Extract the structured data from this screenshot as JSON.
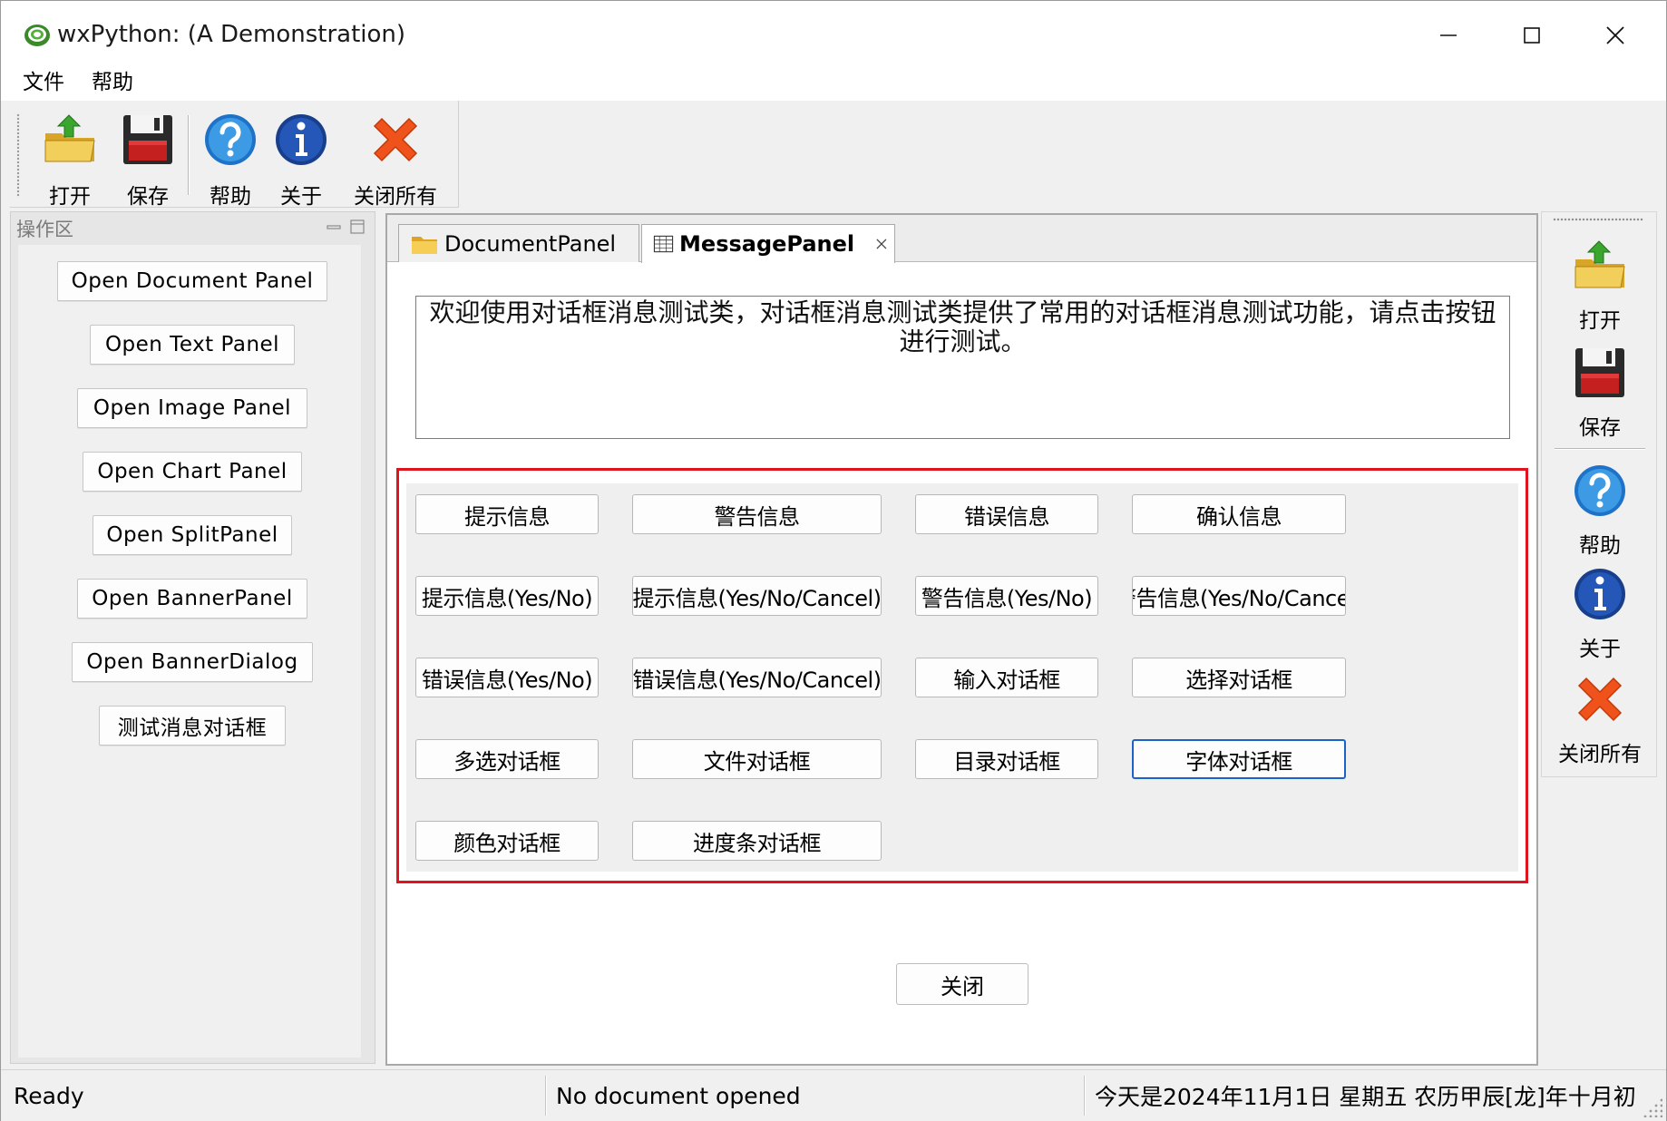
{
  "window": {
    "title": "wxPython: (A Demonstration)"
  },
  "menu": {
    "items": [
      "文件",
      "帮助"
    ]
  },
  "toolbar_top": {
    "items": [
      {
        "label": "打开",
        "icon": "open-folder-icon"
      },
      {
        "label": "保存",
        "icon": "save-disk-icon"
      },
      {
        "label": "帮助",
        "icon": "help-icon"
      },
      {
        "label": "关于",
        "icon": "info-icon"
      },
      {
        "label": "关闭所有",
        "icon": "close-all-icon"
      }
    ]
  },
  "left_pane": {
    "caption": "操作区",
    "buttons": [
      "Open Document Panel",
      "Open Text Panel",
      "Open Image Panel",
      "Open Chart Panel",
      "Open SplitPanel",
      "Open BannerPanel",
      "Open BannerDialog",
      "测试消息对话框"
    ]
  },
  "notebook": {
    "tabs": [
      {
        "label": "DocumentPanel",
        "icon": "folder-icon",
        "active": false
      },
      {
        "label": "MessagePanel",
        "icon": "grid-icon",
        "active": true
      }
    ],
    "message_text": "欢迎使用对话框消息测试类，对话框消息测试类提供了常用的对话框消息测试功能，请点击按钮进行测试。",
    "buttons": [
      [
        "提示信息",
        "警告信息",
        "错误信息",
        "确认信息"
      ],
      [
        "提示信息(Yes/No)",
        "提示信息(Yes/No/Cancel)",
        "警告信息(Yes/No)",
        "警告信息(Yes/No/Cancel)"
      ],
      [
        "错误信息(Yes/No)",
        "错误信息(Yes/No/Cancel)",
        "输入对话框",
        "选择对话框"
      ],
      [
        "多选对话框",
        "文件对话框",
        "目录对话框",
        "字体对话框"
      ],
      [
        "颜色对话框",
        "进度条对话框"
      ]
    ],
    "close_label": "关闭"
  },
  "toolbar_right": {
    "items": [
      {
        "label": "打开",
        "icon": "open-folder-icon"
      },
      {
        "label": "保存",
        "icon": "save-disk-icon"
      },
      {
        "label": "帮助",
        "icon": "help-icon"
      },
      {
        "label": "关于",
        "icon": "info-icon"
      },
      {
        "label": "关闭所有",
        "icon": "close-all-icon"
      }
    ]
  },
  "statusbar": {
    "fields": [
      "Ready",
      "No document opened",
      "今天是2024年11月1日 星期五 农历甲辰[龙]年十月初..."
    ]
  },
  "colors": {
    "highlight_border": "#e0141e",
    "focus_border": "#1a64c8",
    "window_bg": "#f0f0f0"
  }
}
